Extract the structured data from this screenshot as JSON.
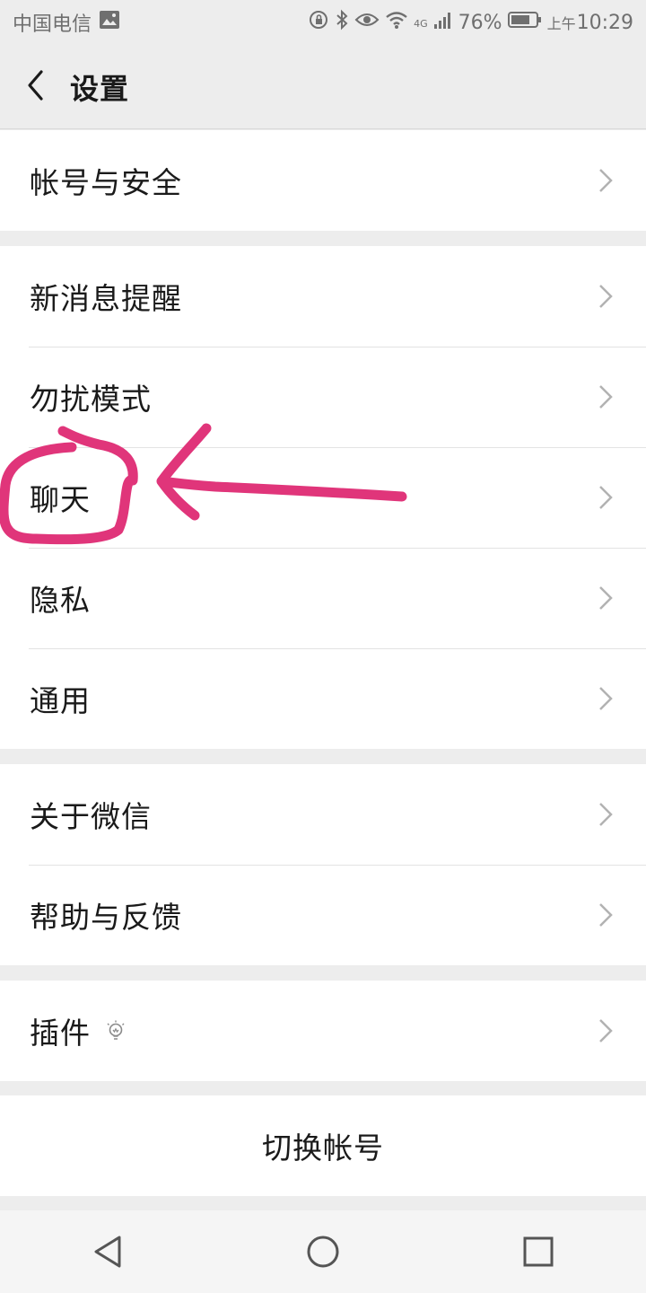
{
  "status_bar": {
    "carrier": "中国电信",
    "network": "4G",
    "battery": "76%",
    "ampm": "上午",
    "time": "10:29",
    "icons": [
      "image-icon",
      "rotation-lock-icon",
      "bluetooth-icon",
      "eye-icon",
      "wifi-icon",
      "signal-icon",
      "battery-icon"
    ]
  },
  "header": {
    "title": "设置",
    "back_icon": "back-arrow-icon"
  },
  "groups": [
    {
      "items": [
        "帐号与安全"
      ]
    },
    {
      "items": [
        "新消息提醒",
        "勿扰模式",
        "聊天",
        "隐私",
        "通用"
      ]
    },
    {
      "items": [
        "关于微信",
        "帮助与反馈"
      ]
    },
    {
      "items": [
        "插件"
      ],
      "plugin_icon": "lightbulb-icon"
    }
  ],
  "switch_account": "切换帐号",
  "nav": {
    "icons": [
      "nav-back-icon",
      "nav-home-icon",
      "nav-recents-icon"
    ]
  },
  "colors": {
    "background": "#ededed",
    "annotation": "#e0357a",
    "text": "#1a1a1a",
    "chevron": "#b2b2b2"
  }
}
